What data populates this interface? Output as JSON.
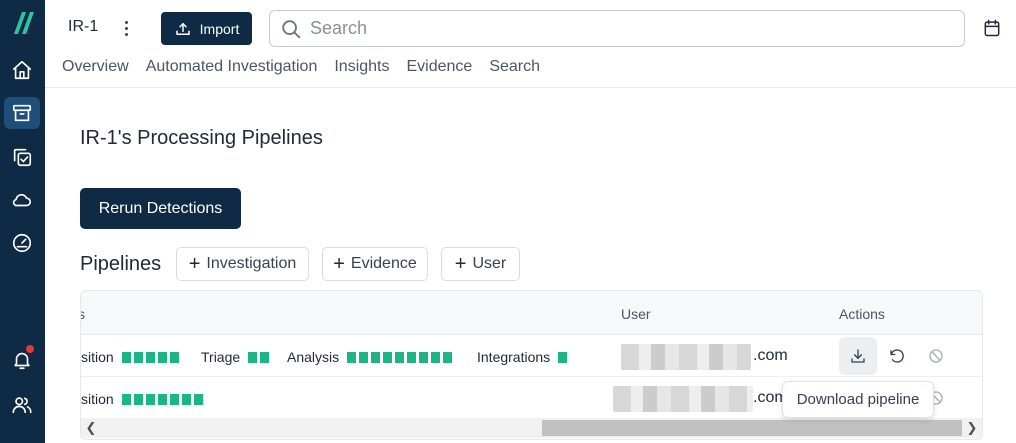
{
  "app": {
    "case_id": "IR-1",
    "import_label": "Import",
    "search_placeholder": "Search"
  },
  "tabs": [
    {
      "label": "Overview"
    },
    {
      "label": "Automated Investigation"
    },
    {
      "label": "Insights"
    },
    {
      "label": "Evidence"
    },
    {
      "label": "Search"
    }
  ],
  "page": {
    "title": "IR-1's Processing Pipelines",
    "rerun_label": "Rerun Detections",
    "pipelines_label": "Pipelines",
    "add_buttons": [
      {
        "label": "Investigation"
      },
      {
        "label": "Evidence"
      },
      {
        "label": "User"
      }
    ]
  },
  "table": {
    "headers": {
      "stages": "s",
      "user": "User",
      "actions": "Actions"
    },
    "rows": [
      {
        "stages": [
          {
            "label": "sition",
            "count": 5
          },
          {
            "label": "Triage",
            "count": 2
          },
          {
            "label": "Analysis",
            "count": 9
          },
          {
            "label": "Integrations",
            "count": 1
          }
        ],
        "user_domain": ".com"
      },
      {
        "stages": [
          {
            "label": "sition",
            "count": 7
          }
        ],
        "user_domain": ".com"
      }
    ]
  },
  "tooltip": {
    "text": "Download pipeline"
  },
  "colors": {
    "sidebar": "#0f2a44",
    "primary_button": "#0f2a44",
    "stage_block": "#1db584",
    "notification_dot": "#e53935"
  },
  "icons": {
    "sidebar": [
      "logo-icon",
      "home-icon",
      "archive-icon",
      "copy-check-icon",
      "cloud-icon",
      "gauge-icon",
      "bell-icon",
      "users-icon"
    ],
    "actions": [
      "download-icon",
      "rerun-icon",
      "cancel-icon"
    ]
  }
}
